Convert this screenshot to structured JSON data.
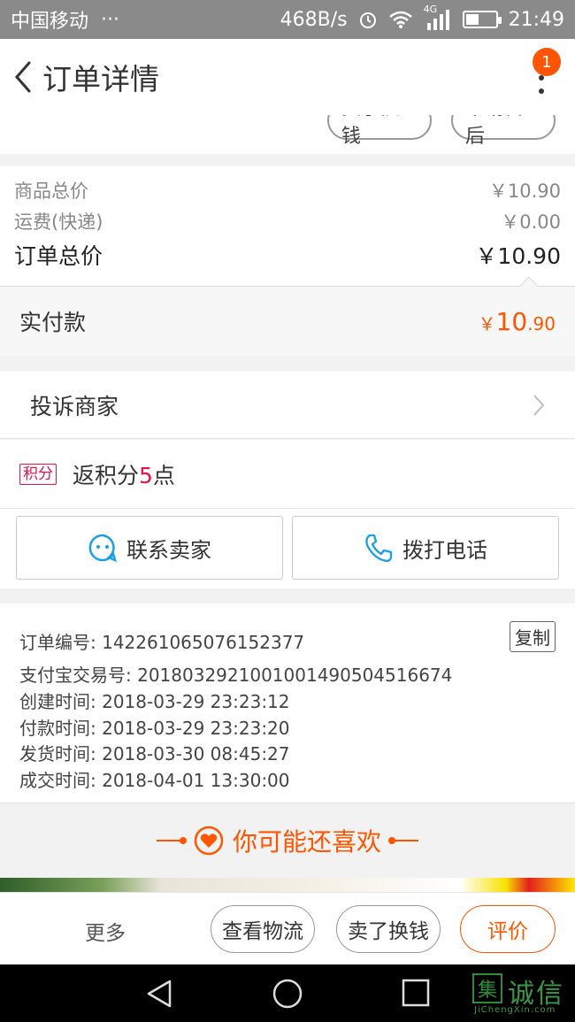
{
  "status_bar": {
    "carrier": "中国移动",
    "dots": "···",
    "net_speed": "468B/s",
    "network": "4G",
    "time": "21:49"
  },
  "header": {
    "title": "订单详情",
    "badge_count": "1"
  },
  "top_strip": {
    "sell_label": "卖了换钱",
    "aftersale_label": "申请售后"
  },
  "price": {
    "goods_total_label": "商品总价",
    "goods_total_value": "￥10.90",
    "shipping_label": "运费(快递)",
    "shipping_value": "￥0.00",
    "order_total_label": "订单总价",
    "order_total_value": "￥10.90"
  },
  "paid": {
    "label": "实付款",
    "currency": "￥",
    "integer": "10",
    "decimal": ".90"
  },
  "complain": {
    "label": "投诉商家"
  },
  "points": {
    "tag": "积分",
    "prefix": "返积分",
    "count": "5",
    "suffix": "点"
  },
  "actions": {
    "contact_seller": "联系卖家",
    "call_phone": "拨打电话"
  },
  "order_info": {
    "order_no": "订单编号: 142261065076152377",
    "copy_label": "复制",
    "alipay_no": "支付宝交易号: 2018032921001001490504516674",
    "created": "创建时间: 2018-03-29 23:23:12",
    "paid": "付款时间: 2018-03-29 23:23:20",
    "shipped": "发货时间: 2018-03-30 08:45:27",
    "completed": "成交时间: 2018-04-01 13:30:00"
  },
  "recommend": {
    "title": "你可能还喜欢"
  },
  "bottom_bar": {
    "more": "更多",
    "logistics": "查看物流",
    "sell": "卖了换钱",
    "review": "评价"
  },
  "watermark": {
    "brand_box": "集",
    "brand": "诚信",
    "url": "JiChengXin.com"
  },
  "colors": {
    "accent": "#ff5500",
    "points": "#e0144b",
    "contact_icon": "#1aa0e6"
  },
  "icons": {
    "back": "chevron-left-icon",
    "more": "vertical-dots-icon",
    "complain_arrow": "chevron-right-icon",
    "contact": "chat-bubble-icon",
    "phone": "phone-icon",
    "heart": "heart-circle-icon"
  }
}
